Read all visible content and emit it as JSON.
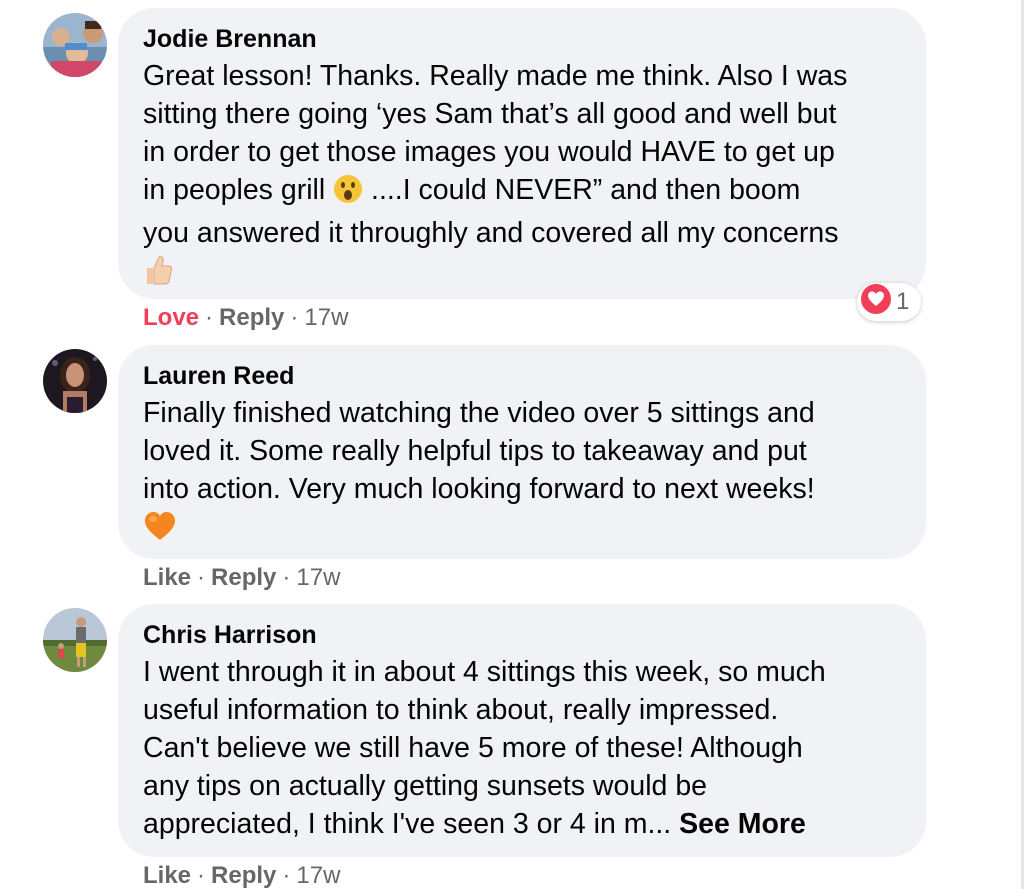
{
  "comments": [
    {
      "author": "Jodie Brennan",
      "lines": [
        "Great lesson! Thanks. Really made me think. Also I was",
        "sitting there going ‘yes Sam that’s all good and well but",
        "in order to get those images you would HAVE to get up",
        "in peoples grill",
        "....I could NEVER” and then boom",
        "you answered it throughly and covered all my concerns"
      ],
      "inline_emoji_icon": "surprised-face-icon",
      "trailing_emoji_icon": "thumbs-up-icon",
      "action_primary": "Love",
      "action_primary_state": "reacted",
      "action_primary_color": "#f33e58",
      "reply_label": "Reply",
      "separator": "·",
      "timestamp": "17w",
      "reaction": {
        "icon": "heart-reaction-icon",
        "count": "1",
        "color": "#f33e58"
      }
    },
    {
      "author": "Lauren Reed",
      "lines": [
        "Finally finished watching the video over 5 sittings and",
        "loved it. Some really helpful tips to takeaway and put",
        "into action. Very much looking forward to next weeks!"
      ],
      "trailing_emoji_icon": "orange-heart-icon",
      "action_primary": "Like",
      "reply_label": "Reply",
      "separator": "·",
      "timestamp": "17w"
    },
    {
      "author": "Chris Harrison",
      "lines": [
        "I went through it in about 4 sittings this week, so much",
        "useful information to think about, really impressed.",
        "Can't believe we still have 5 more of these! Although",
        "any tips on actually getting sunsets would be",
        "appreciated, I think I've seen 3 or 4 in m..."
      ],
      "see_more_label": "See More",
      "action_primary": "Like",
      "reply_label": "Reply",
      "separator": "·",
      "timestamp": "17w"
    }
  ],
  "colors": {
    "bubble_background": "#f0f2f5",
    "secondary_text": "#65676b",
    "primary_text": "#050505",
    "love_red": "#f33e58"
  }
}
